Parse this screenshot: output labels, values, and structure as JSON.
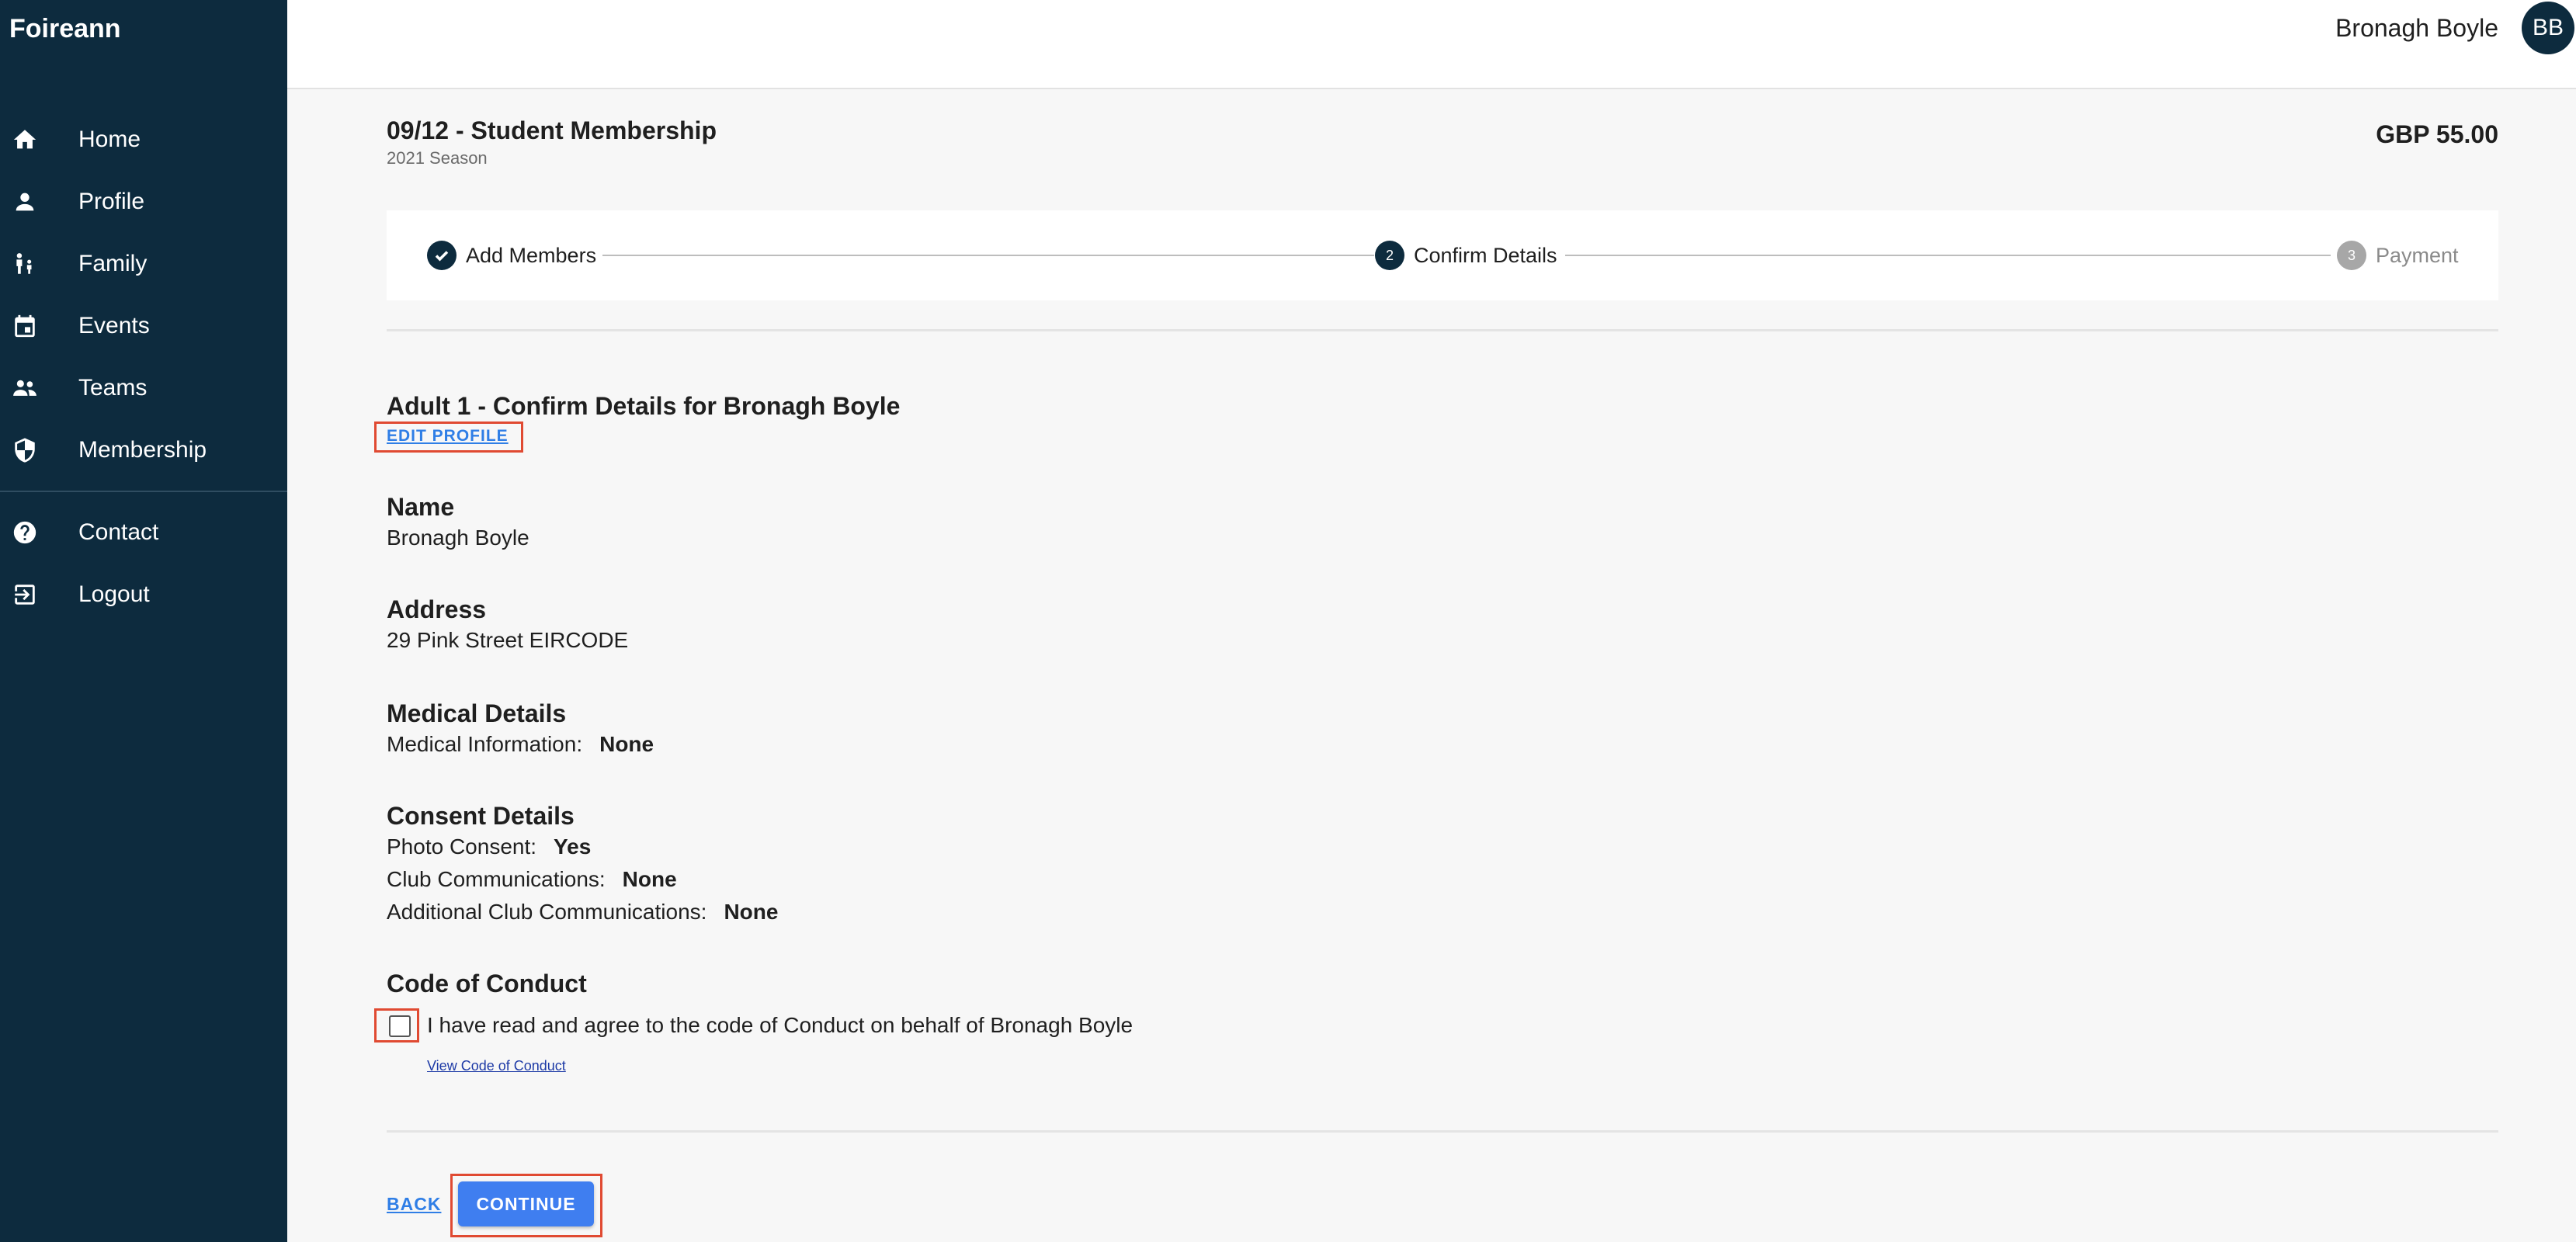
{
  "app": {
    "brand": "Foireann"
  },
  "sidebar": {
    "items": [
      {
        "label": "Home",
        "icon": "home-icon"
      },
      {
        "label": "Profile",
        "icon": "person-icon"
      },
      {
        "label": "Family",
        "icon": "family-icon"
      },
      {
        "label": "Events",
        "icon": "calendar-icon"
      },
      {
        "label": "Teams",
        "icon": "group-icon"
      },
      {
        "label": "Membership",
        "icon": "shield-icon"
      }
    ],
    "secondary": [
      {
        "label": "Contact",
        "icon": "help-icon"
      },
      {
        "label": "Logout",
        "icon": "logout-icon"
      }
    ]
  },
  "header": {
    "user_name": "Bronagh Boyle",
    "avatar_initials": "BB"
  },
  "membership": {
    "title": "09/12 - Student Membership",
    "season": "2021 Season",
    "price": "GBP 55.00"
  },
  "stepper": {
    "steps": [
      {
        "label": "Add Members",
        "state": "completed"
      },
      {
        "number": "2",
        "label": "Confirm Details",
        "state": "active"
      },
      {
        "number": "3",
        "label": "Payment",
        "state": "pending"
      }
    ]
  },
  "details": {
    "heading": "Adult 1 - Confirm Details for Bronagh Boyle",
    "edit_profile": "EDIT PROFILE",
    "name_label": "Name",
    "name_value": "Bronagh Boyle",
    "address_label": "Address",
    "address_value": "29 Pink Street EIRCODE",
    "medical_label": "Medical Details",
    "medical_info_label": "Medical Information:",
    "medical_info_value": "None",
    "consent_label": "Consent Details",
    "photo_consent_label": "Photo Consent:",
    "photo_consent_value": "Yes",
    "club_comms_label": "Club Communications:",
    "club_comms_value": "None",
    "additional_comms_label": "Additional Club Communications:",
    "additional_comms_value": "None",
    "coc_label": "Code of Conduct",
    "coc_agree": "I have read and agree to the code of Conduct on behalf of Bronagh Boyle",
    "coc_link": "View Code of Conduct"
  },
  "actions": {
    "back": "BACK",
    "continue": "CONTINUE"
  },
  "colors": {
    "sidebar": "#0d2b3e",
    "accent": "#3f7ef0",
    "link": "#2f7ee6",
    "highlight": "#e04a32"
  }
}
